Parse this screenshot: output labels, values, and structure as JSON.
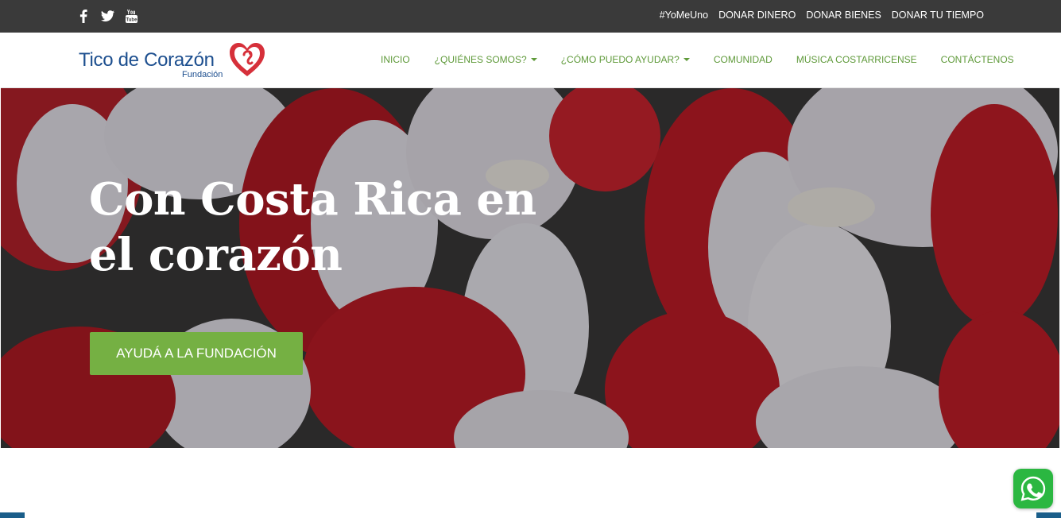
{
  "topbar": {
    "social": [
      {
        "name": "facebook-icon"
      },
      {
        "name": "twitter-icon"
      },
      {
        "name": "youtube-icon"
      }
    ],
    "links": [
      "#YoMeUno",
      "DONAR DINERO",
      "DONAR BIENES",
      "DONAR TU TIEMPO"
    ]
  },
  "logo": {
    "title": "Tico de Corazón",
    "subtitle": "Fundación"
  },
  "nav": {
    "items": [
      {
        "label": "INICIO",
        "dropdown": false
      },
      {
        "label": "¿QUIÉNES SOMOS?",
        "dropdown": true
      },
      {
        "label": "¿CÓMO PUEDO AYUDAR?",
        "dropdown": true
      },
      {
        "label": "COMUNIDAD",
        "dropdown": false
      },
      {
        "label": "MÚSICA COSTARRICENSE",
        "dropdown": false
      },
      {
        "label": "CONTÁCTENOS",
        "dropdown": false
      }
    ]
  },
  "hero": {
    "title_line1": "Con Costa Rica en",
    "title_line2": "el corazón",
    "button_label": "AYUDÁ A LA FUNDACIÓN"
  },
  "colors": {
    "topbar": "#3a3a3a",
    "nav_text": "#5f9a3a",
    "button": "#75b043",
    "logo_blue": "#1d4f8f",
    "logo_red": "#d6303a",
    "whatsapp": "#2bb741"
  },
  "whatsapp": {
    "icon": "whatsapp-icon"
  }
}
